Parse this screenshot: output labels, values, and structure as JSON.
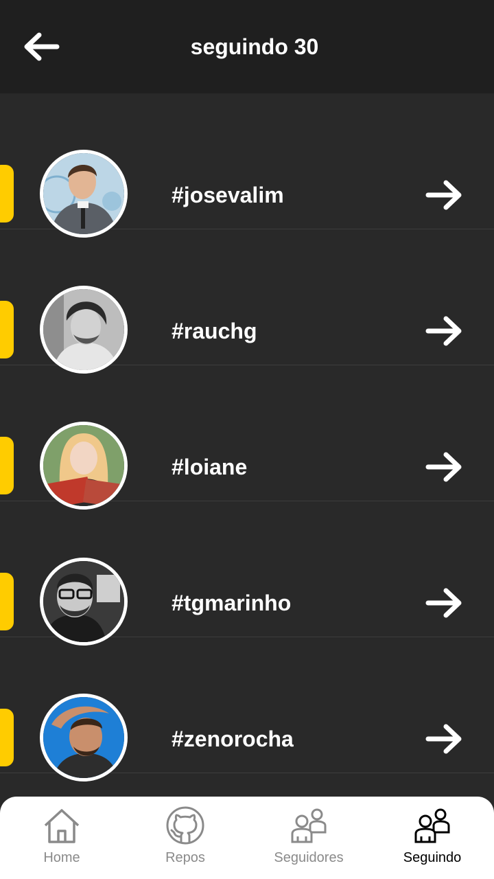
{
  "header": {
    "title": "seguindo 30"
  },
  "following": [
    {
      "username": "#josevalim"
    },
    {
      "username": "#rauchg"
    },
    {
      "username": "#loiane"
    },
    {
      "username": "#tgmarinho"
    },
    {
      "username": "#zenorocha"
    }
  ],
  "tabs": [
    {
      "label": "Home",
      "icon": "home-icon",
      "active": false
    },
    {
      "label": "Repos",
      "icon": "github-icon",
      "active": false
    },
    {
      "label": "Seguidores",
      "icon": "followers-icon",
      "active": false
    },
    {
      "label": "Seguindo",
      "icon": "following-icon",
      "active": true
    }
  ],
  "colors": {
    "background": "#292929",
    "header": "#1f1f1f",
    "accent": "#ffcc00",
    "tab_inactive": "#8a8a8a",
    "tab_active": "#000000"
  }
}
